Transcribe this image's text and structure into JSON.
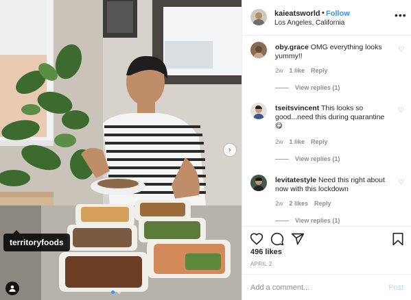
{
  "photo": {
    "tag_label": "territoryfoods",
    "carousel_total": 2,
    "carousel_active": 1
  },
  "post": {
    "username": "kaieatsworld",
    "separator": "•",
    "follow_label": "Follow",
    "location": "Los Angeles, California"
  },
  "comments": [
    {
      "username": "oby.grace",
      "text": "OMG everything looks yummy!!",
      "time": "2w",
      "likes": "1 like",
      "reply_label": "Reply",
      "view_replies": "View replies (1)"
    },
    {
      "username": "tseitsvincent",
      "text": "This looks so good...need this during quarantine",
      "emoji": "😋",
      "time": "2w",
      "likes": "1 like",
      "reply_label": "Reply",
      "view_replies": "View replies (1)"
    },
    {
      "username": "levitatestyle",
      "text": "Need this right about now with this lockdown",
      "time": "2w",
      "likes": "2 likes",
      "reply_label": "Reply",
      "view_replies": "View replies (1)"
    }
  ],
  "actions": {
    "likes": "496 likes",
    "date": "APRIL 2"
  },
  "add_comment": {
    "placeholder": "Add a comment...",
    "post_label": "Post"
  },
  "colors": {
    "link_blue": "#3897f0",
    "muted": "#8e8e8e",
    "post_disabled": "#b2dffc"
  },
  "icons": [
    "next-arrow-icon",
    "user-tag-icon",
    "more-options-icon",
    "heart-icon",
    "comment-icon",
    "share-icon",
    "bookmark-icon"
  ]
}
